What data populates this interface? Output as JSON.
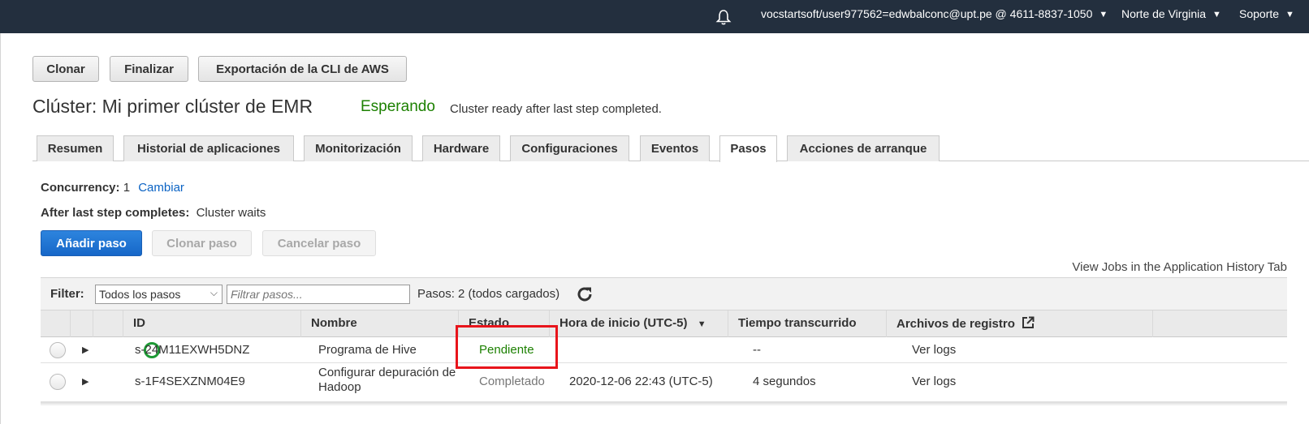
{
  "topbar": {
    "account": "vocstartsoft/user977562=edwbalconc@upt.pe @ 4611-8837-1050",
    "region": "Norte de Virginia",
    "support": "Soporte"
  },
  "actions": {
    "clone": "Clonar",
    "terminate": "Finalizar",
    "export_cli": "Exportación de la CLI de AWS"
  },
  "cluster": {
    "title": "Clúster: Mi primer clúster de EMR",
    "state": "Esperando",
    "state_message": "Cluster ready after last step completed."
  },
  "tabs": [
    {
      "label": "Resumen"
    },
    {
      "label": "Historial de aplicaciones"
    },
    {
      "label": "Monitorización"
    },
    {
      "label": "Hardware"
    },
    {
      "label": "Configuraciones"
    },
    {
      "label": "Eventos"
    },
    {
      "label": "Pasos"
    },
    {
      "label": "Acciones de arranque"
    }
  ],
  "active_tab": "Pasos",
  "steps_panel": {
    "concurrency_label": "Concurrency:",
    "concurrency_value": "1",
    "concurrency_change": "Cambiar",
    "after_last_label": "After last step completes:",
    "after_last_value": "Cluster waits",
    "add_step": "Añadir paso",
    "clone_step": "Clonar paso",
    "cancel_step": "Cancelar paso",
    "view_jobs": "View Jobs in the Application History Tab"
  },
  "filter": {
    "label": "Filter:",
    "selected": "Todos los pasos",
    "placeholder": "Filtrar pasos...",
    "count": "Pasos: 2 (todos cargados)"
  },
  "table": {
    "headers": {
      "id": "ID",
      "name": "Nombre",
      "status": "Estado",
      "start": "Hora de inicio (UTC-5)",
      "elapsed": "Tiempo transcurrido",
      "logs": "Archivos de registro"
    },
    "rows": [
      {
        "id": "s-24M11EXWH5DNZ",
        "name": "Programa de Hive",
        "name_line2": "",
        "status": "Pendiente",
        "start": "",
        "elapsed": "--",
        "logs": "Ver logs"
      },
      {
        "id": "s-1F4SEXZNM04E9",
        "name": "Configurar depuración de",
        "name_line2": "Hadoop",
        "status": "Completado",
        "start": "2020-12-06 22:43 (UTC-5)",
        "elapsed": "4 segundos",
        "logs": "Ver logs"
      }
    ]
  },
  "colors": {
    "topbar": "#232f3e",
    "status_green": "#1d8102",
    "link": "#0b63c4",
    "primary_button": "#1667c8",
    "highlight": "#e8141b"
  }
}
